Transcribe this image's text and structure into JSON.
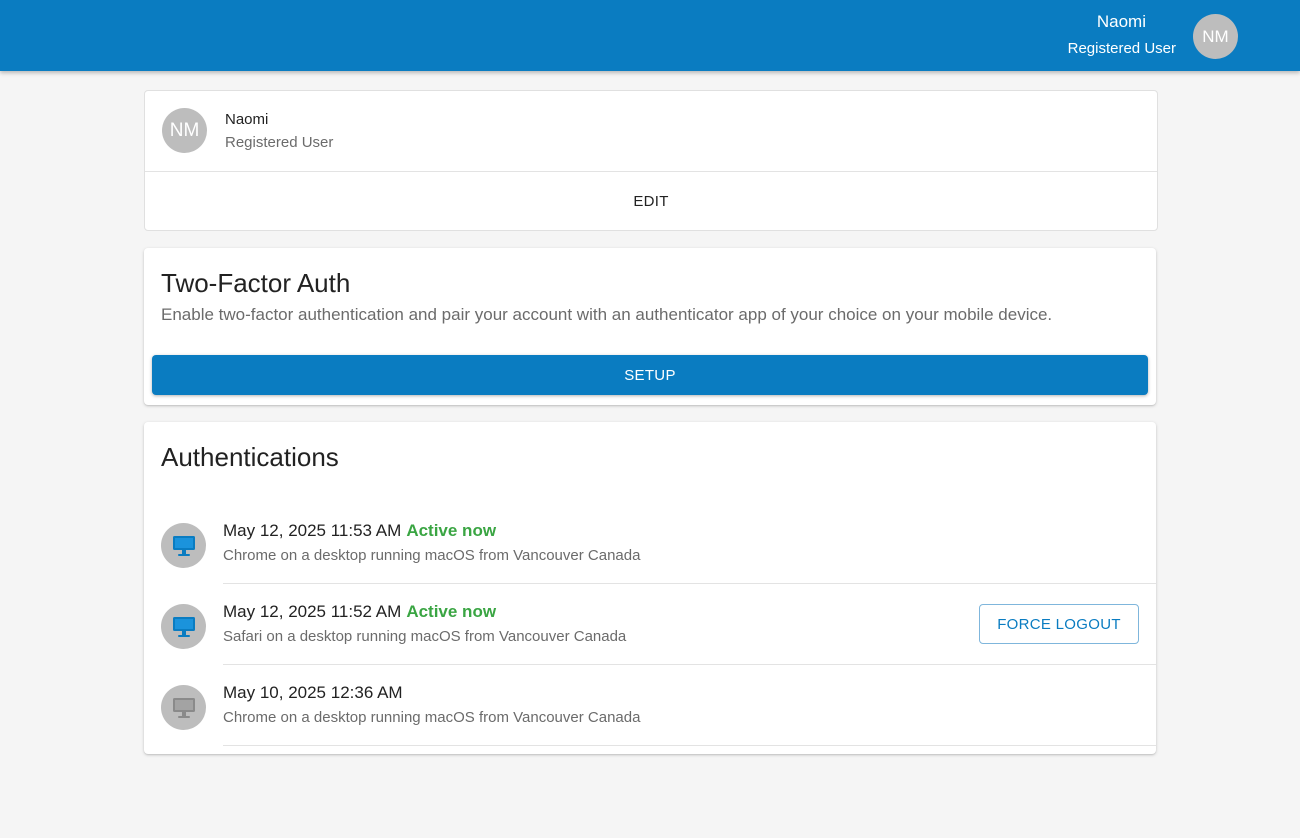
{
  "header": {
    "user_name": "Naomi",
    "user_role": "Registered User",
    "avatar_initials": "NM",
    "bar_color": "#0a7cc1"
  },
  "profile": {
    "avatar_initials": "NM",
    "name": "Naomi",
    "role": "Registered User",
    "edit_label": "EDIT"
  },
  "two_factor": {
    "title": "Two-Factor Auth",
    "description": "Enable two-factor authentication and pair your account with an authenticator app of your choice on your mobile device.",
    "setup_label": "SETUP"
  },
  "authentications": {
    "title": "Authentications",
    "force_logout_label": "FORCE LOGOUT",
    "sessions": [
      {
        "timestamp": "May 12, 2025 11:53 AM",
        "status": "Active now",
        "description": "Chrome on a desktop running macOS from Vancouver Canada",
        "icon": "desktop-monitor-icon",
        "icon_color": "#0a7cc1"
      },
      {
        "timestamp": "May 12, 2025 11:52 AM",
        "status": "Active now",
        "description": "Safari on a desktop running macOS from Vancouver Canada",
        "icon": "desktop-monitor-icon",
        "icon_color": "#0a7cc1"
      },
      {
        "timestamp": "May 10, 2025 12:36 AM",
        "status": "",
        "description": "Chrome on a desktop running macOS from Vancouver Canada",
        "icon": "desktop-monitor-icon",
        "icon_color": "#8a8a8a"
      }
    ]
  }
}
